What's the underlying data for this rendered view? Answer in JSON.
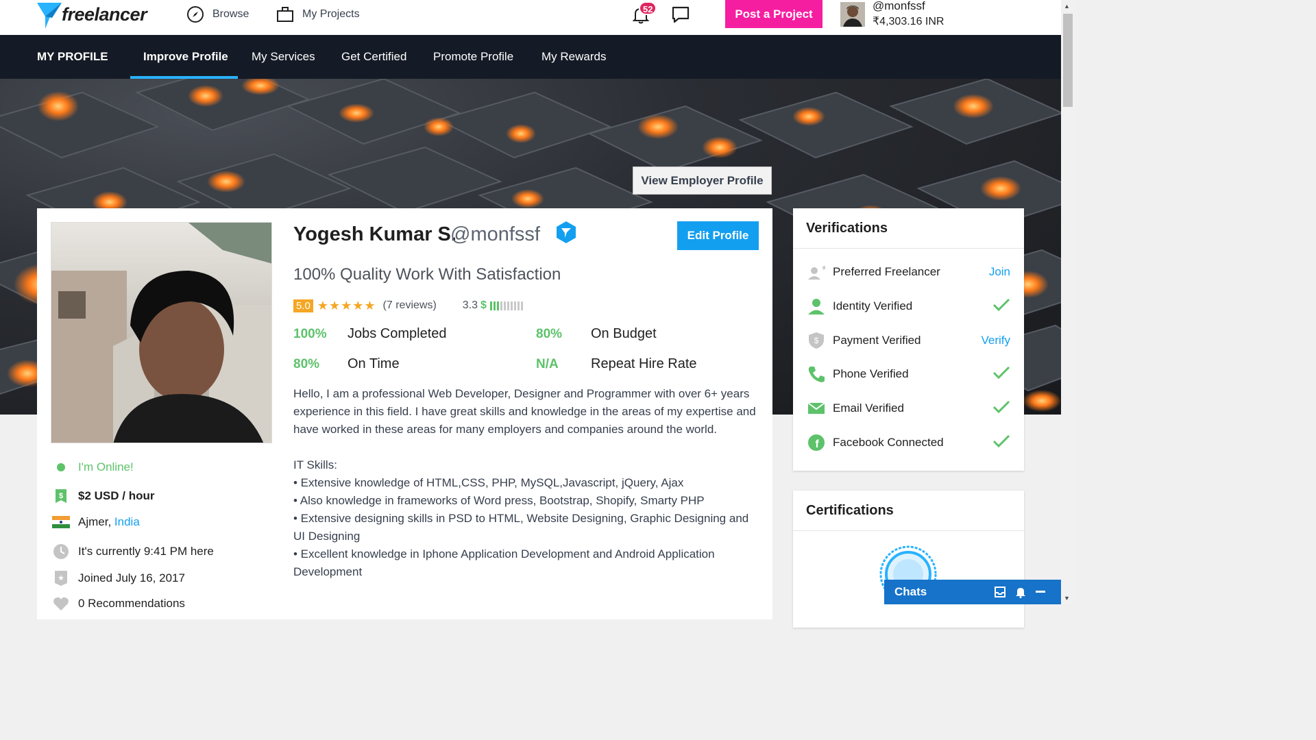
{
  "topbar": {
    "logo_text": "freelancer",
    "browse_label": "Browse",
    "projects_label": "My Projects",
    "notification_count": "52",
    "post_project_label": "Post a Project",
    "username": "@monfssf",
    "balance": "₹4,303.16 INR"
  },
  "subnav": {
    "items": [
      "MY PROFILE",
      "Improve Profile",
      "My Services",
      "Get Certified",
      "Promote Profile",
      "My Rewards"
    ],
    "active": "Improve Profile"
  },
  "hero": {
    "view_employer_label": "View Employer Profile"
  },
  "profile": {
    "name": "Yogesh Kumar S.",
    "handle": "@monfssf",
    "edit_label": "Edit Profile",
    "tagline": "100% Quality Work With Satisfaction",
    "rating": "5.0",
    "reviews": "(7 reviews)",
    "earnings_score": "3.3",
    "earnings_symbol": "$",
    "earnings_level_of_10": 3,
    "stats": [
      {
        "value": "100%",
        "label": "Jobs Completed"
      },
      {
        "value": "80%",
        "label": "On Budget"
      },
      {
        "value": "80%",
        "label": "On Time"
      },
      {
        "value": "N/A",
        "label": "Repeat Hire Rate"
      }
    ],
    "about": "Hello, I am a professional Web Developer, Designer and Programmer with over 6+ years experience in this field. I have great skills and knowledge in the areas of my expertise and have worked in these areas for many employers and companies around the world.\n\nIT Skills:\n• Extensive knowledge of HTML,CSS, PHP, MySQL,Javascript, jQuery, Ajax\n• Also knowledge in frameworks of Word press, Bootstrap, Shopify, Smarty PHP\n• Extensive designing skills in PSD to HTML, Website Designing, Graphic Designing and UI Designing\n• Excellent knowledge in Iphone Application Development and Android Application Development"
  },
  "sidebar": {
    "online": "I'm Online!",
    "rate": "$2 USD / hour",
    "city": "Ajmer,",
    "country": "India",
    "local_time": "It's currently 9:41 PM here",
    "joined": "Joined July 16, 2017",
    "recommendations": "0 Recommendations"
  },
  "verifications": {
    "title": "Verifications",
    "items": [
      {
        "label": "Preferred Freelancer",
        "action": "Join"
      },
      {
        "label": "Identity Verified",
        "action": "check"
      },
      {
        "label": "Payment Verified",
        "action": "Verify"
      },
      {
        "label": "Phone Verified",
        "action": "check"
      },
      {
        "label": "Email Verified",
        "action": "check"
      },
      {
        "label": "Facebook Connected",
        "action": "check"
      }
    ]
  },
  "certifications": {
    "title": "Certifications"
  },
  "chats": {
    "label": "Chats"
  },
  "colors": {
    "accent_blue": "#139ff0",
    "post_pink": "#f51ea1",
    "nav_dark": "#151b26",
    "success_green": "#5dc26a",
    "star_orange": "#f5a623"
  }
}
